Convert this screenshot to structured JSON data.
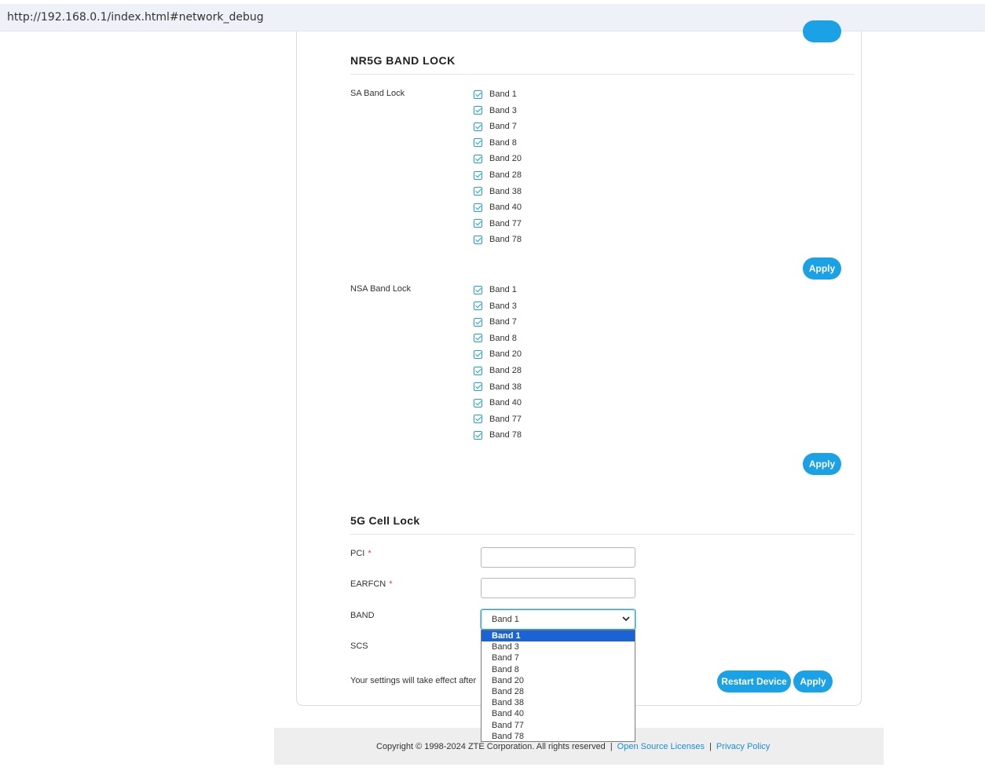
{
  "browser": {
    "url": "http://192.168.0.1/index.html#network_debug"
  },
  "nr5g_band_lock": {
    "title": "NR5G BAND LOCK",
    "sa": {
      "label": "SA Band Lock",
      "bands": [
        "Band 1",
        "Band 3",
        "Band 7",
        "Band 8",
        "Band 20",
        "Band 28",
        "Band 38",
        "Band 40",
        "Band 77",
        "Band 78"
      ],
      "checked": [
        true,
        true,
        true,
        true,
        true,
        true,
        true,
        true,
        true,
        true
      ],
      "apply_label": "Apply"
    },
    "nsa": {
      "label": "NSA Band Lock",
      "bands": [
        "Band 1",
        "Band 3",
        "Band 7",
        "Band 8",
        "Band 20",
        "Band 28",
        "Band 38",
        "Band 40",
        "Band 77",
        "Band 78"
      ],
      "checked": [
        true,
        true,
        true,
        true,
        true,
        true,
        true,
        true,
        true,
        true
      ],
      "apply_label": "Apply"
    }
  },
  "cell_lock": {
    "title": "5G Cell Lock",
    "pci_label": "PCI",
    "pci_value": "",
    "earfcn_label": "EARFCN",
    "earfcn_value": "",
    "required_mark": "*",
    "band_label": "BAND",
    "band_selected": "Band 1",
    "band_options": [
      "Band 1",
      "Band 3",
      "Band 7",
      "Band 8",
      "Band 20",
      "Band 28",
      "Band 38",
      "Band 40",
      "Band 77",
      "Band 78"
    ],
    "scs_label": "SCS",
    "notice": "Your settings will take effect after",
    "restart_label": "Restart Device",
    "apply_label": "Apply"
  },
  "footer": {
    "copyright": "Copyright © 1998-2024 ZTE Corporation. All rights reserved",
    "open_source": "Open Source Licenses",
    "privacy": "Privacy Policy",
    "separator": "|"
  },
  "colors": {
    "accent": "#1aa1e6",
    "selected_option": "#1a63d6"
  }
}
